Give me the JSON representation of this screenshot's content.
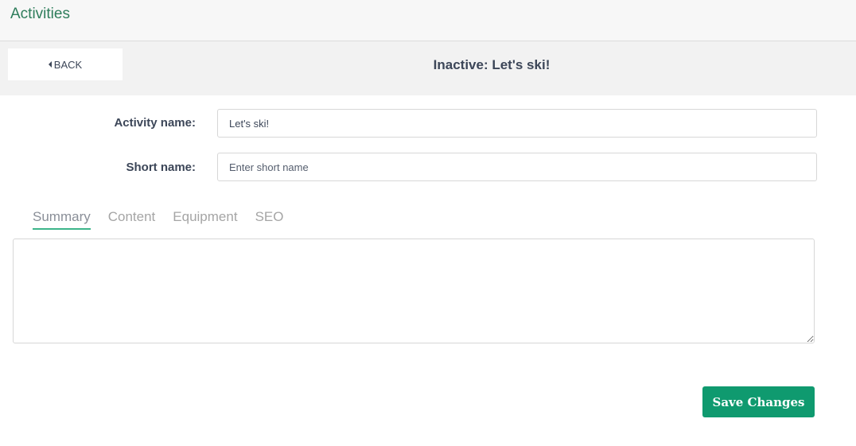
{
  "header": {
    "title": "Activities"
  },
  "subheader": {
    "back_label": "BACK",
    "page_title": "Inactive: Let's ski!"
  },
  "form": {
    "activity_name": {
      "label": "Activity name:",
      "value": "Let's ski!"
    },
    "short_name": {
      "label": "Short name:",
      "value": "",
      "placeholder": "Enter short name"
    }
  },
  "tabs": [
    {
      "label": "Summary",
      "active": true
    },
    {
      "label": "Content",
      "active": false
    },
    {
      "label": "Equipment",
      "active": false
    },
    {
      "label": "SEO",
      "active": false
    }
  ],
  "summary": {
    "value": ""
  },
  "actions": {
    "save_label": "Save Changes"
  },
  "colors": {
    "brand_green": "#0f9a6f",
    "tab_underline": "#3cb58a",
    "title_green": "#2e7d5b"
  }
}
